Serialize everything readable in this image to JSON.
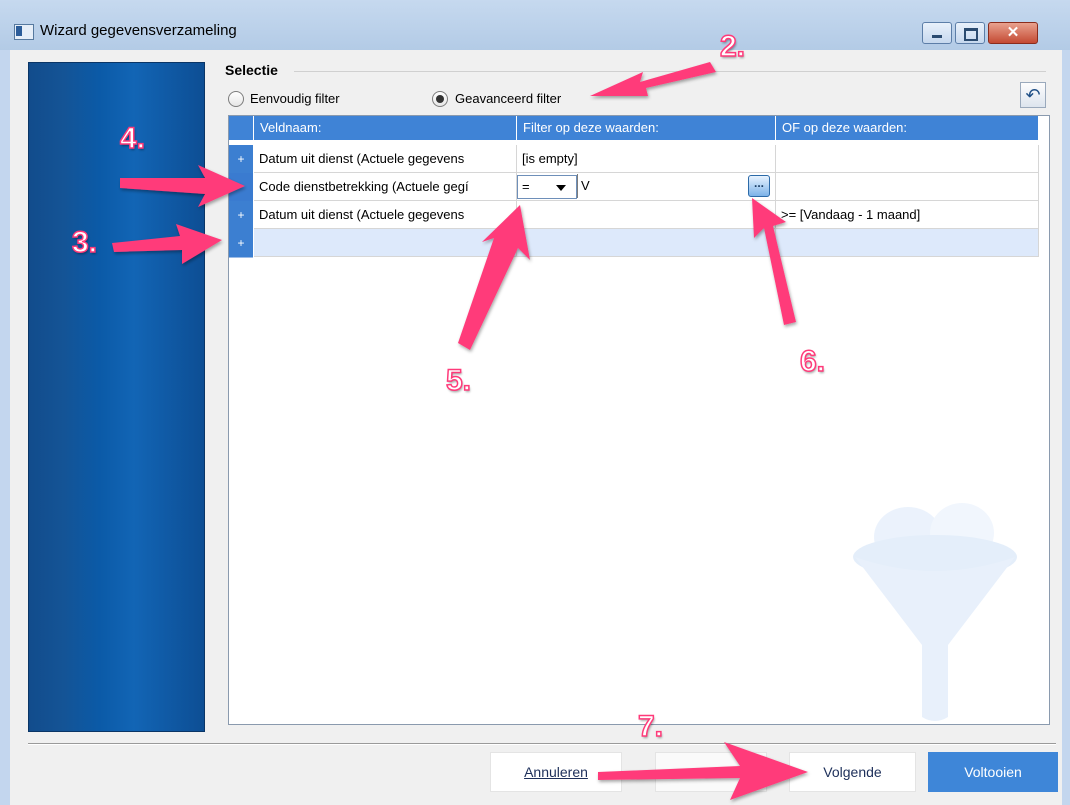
{
  "window": {
    "title": "Wizard gegevensverzameling"
  },
  "selectie": {
    "title": "Selectie",
    "radio_simple": "Eenvoudig filter",
    "radio_advanced": "Geavanceerd filter",
    "selected": "Geavanceerd filter"
  },
  "grid": {
    "headers": [
      "Veldnaam:",
      "Filter op deze waarden:",
      "OF op deze waarden:"
    ],
    "rows": [
      {
        "marker": "+",
        "field": "Datum uit dienst (Actuele gegevens",
        "filter": "[is empty]",
        "or": ""
      },
      {
        "marker": "",
        "field": "Code dienstbetrekking (Actuele gegí",
        "operator": "=",
        "filter": "V",
        "or": ""
      },
      {
        "marker": "+",
        "field": "Datum uit dienst (Actuele gegevens",
        "filter": "",
        "or": ">= [Vandaag - 1 maand]"
      },
      {
        "marker": "+",
        "field": "",
        "filter": "",
        "or": ""
      }
    ],
    "ellipsis": "..."
  },
  "buttons": {
    "cancel": "Annuleren",
    "next": "Volgende",
    "finish": "Voltooien"
  },
  "annotations": [
    "2.",
    "3.",
    "4.",
    "5.",
    "6.",
    "7."
  ],
  "colors": {
    "header_blue": "#3f83d6",
    "accent_pink": "#ff3a7a",
    "finish_button": "#3e86d8"
  }
}
